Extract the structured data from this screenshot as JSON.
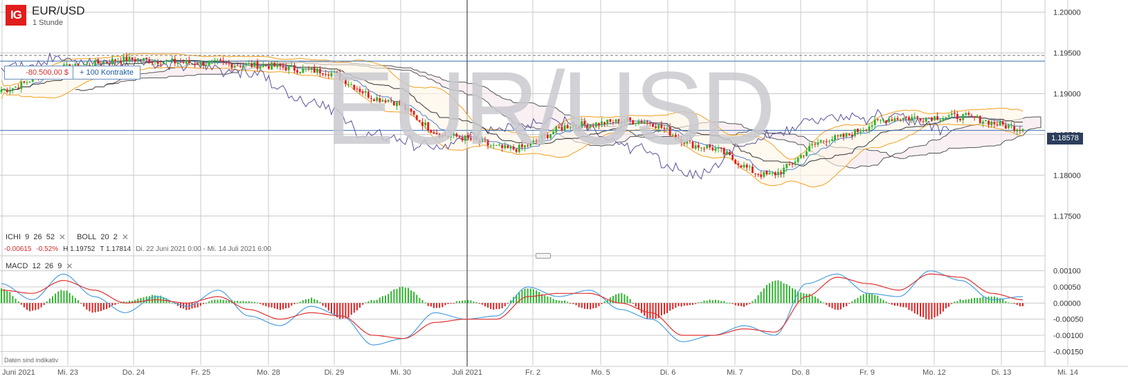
{
  "header": {
    "logo": "IG",
    "instrument": "EUR/USD",
    "timeframe": "1 Stunde",
    "watermark": "EUR/USD"
  },
  "position": {
    "pl": "-80.500,00 $",
    "quantity": "+ 100 Kontrakte"
  },
  "current_price": "1.18578",
  "indicators": {
    "ichimoku": {
      "name": "ICHI",
      "params": [
        "9",
        "26",
        "52"
      ]
    },
    "bollinger": {
      "name": "BOLL",
      "params": [
        "20",
        "2"
      ]
    },
    "macd": {
      "name": "MACD",
      "params": [
        "12",
        "26",
        "9"
      ]
    }
  },
  "stats": {
    "change_abs": "-0.00615",
    "change_pct": "-0.52%",
    "high_label": "H 1.19752",
    "low_label": "T 1.17814",
    "range": "Di. 22 Juni 2021 0:00 - Mi. 14 Juli 2021 6:00"
  },
  "footnote": "Daten sind indikativ",
  "close_symbol": "✕",
  "colors": {
    "up": "#2db52d",
    "down": "#e02020",
    "bollinger": "#f0a020",
    "ichimoku_lead": "#555555",
    "ichimoku_lag": "#5a4f9a",
    "tenkan": "#4a7fd0",
    "macd": "#4a9fe0",
    "signal": "#e03030",
    "logo": "#e11d1d",
    "price_tag": "#2c3e5c"
  },
  "chart_data": [
    {
      "type": "candlestick",
      "title": "EUR/USD",
      "y_ticks": [
        "1.20000",
        "1.19500",
        "1.19000",
        "1.18500",
        "1.18000",
        "1.17500"
      ],
      "ylim": [
        1.1735,
        1.2015
      ],
      "x_ticks": [
        "Juni 2021",
        "Mi. 23",
        "Do. 24",
        "Fr. 25",
        "Mo. 28",
        "Di. 29",
        "Mi. 30",
        "Juli 2021",
        "Fr. 2",
        "Mo. 5",
        "Di. 6",
        "Mi. 7",
        "Do. 8",
        "Fr. 9",
        "Mo. 12",
        "Di. 13",
        "Mi. 14"
      ],
      "x_tick_bold": [
        "Juni 2021",
        "Juli 2021"
      ],
      "grid": true,
      "reference_lines": [
        1.1947,
        1.194,
        1.1855
      ],
      "session_closes": [
        1.1905,
        1.1932,
        1.1942,
        1.1938,
        1.1935,
        1.1928,
        1.1893,
        1.1848,
        1.1832,
        1.1862,
        1.1867,
        1.1835,
        1.18,
        1.1845,
        1.187,
        1.1872,
        1.1858
      ],
      "high": 1.19752,
      "low": 1.17814,
      "last": 1.18578
    },
    {
      "type": "bar",
      "title": "MACD",
      "y_ticks": [
        "0.00100",
        "0.00050",
        "0.00000",
        "-0.00050",
        "-0.00100",
        "-0.00150"
      ],
      "ylim": [
        -0.00175,
        0.00125
      ],
      "histogram_anchors": [
        0.00045,
        -0.00025,
        0.0004,
        -0.0003,
        5e-05,
        0.00025,
        -0.0002,
        0.0001,
        5e-05,
        -0.0002,
        0.00015,
        -0.0005,
        0.0001,
        0.0005,
        -0.00015,
        0.0001,
        -0.0002,
        0.00045,
        0.0001,
        -0.0002,
        0.0003,
        -0.0005,
        -0.0001,
        0.0001,
        -0.0001,
        0.0007,
        0.0003,
        -0.0002,
        0.0003,
        -0.0001,
        -0.0005,
        0.0001,
        0.0002,
        -0.0001
      ],
      "macd_anchors": [
        0.0006,
        0.0001,
        0.0009,
        0.0002,
        -0.0003,
        0.0002,
        -0.0001,
        0.0004,
        -0.0004,
        -0.0007,
        -0.0001,
        -0.0004,
        -0.0013,
        -0.0011,
        -0.0003,
        -0.0005,
        -0.0004,
        0.0005,
        0.0002,
        0.0004,
        -0.0002,
        -0.0005,
        -0.0012,
        -0.001,
        -0.0007,
        -0.001,
        0.0006,
        0.0009,
        0.0003,
        0.0002,
        0.001,
        0.0007,
        0.0001,
        0.0002
      ],
      "signal_anchors": [
        0.0004,
        0.0003,
        0.0007,
        0.0004,
        0.0,
        0.0001,
        0.0,
        0.0002,
        -0.0002,
        -0.0005,
        -0.0003,
        -0.0004,
        -0.001,
        -0.0011,
        -0.0006,
        -0.0005,
        -0.0005,
        0.0002,
        0.0003,
        0.0003,
        0.0,
        -0.0003,
        -0.001,
        -0.001,
        -0.0008,
        -0.0009,
        0.0002,
        0.0008,
        0.0006,
        0.0004,
        0.0009,
        0.0008,
        0.0003,
        0.0001
      ]
    }
  ]
}
